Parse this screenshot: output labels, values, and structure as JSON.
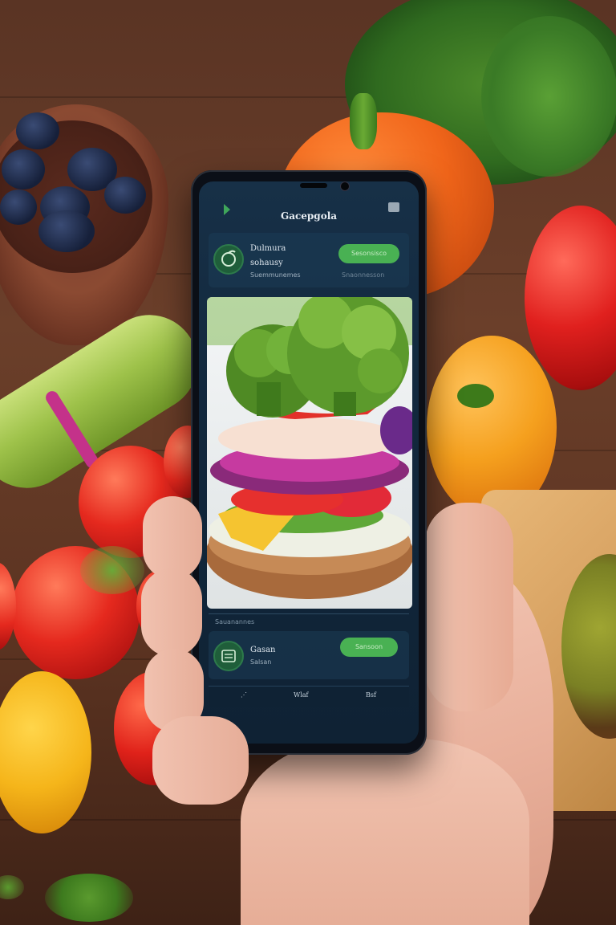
{
  "app": {
    "title": "Gacepgola"
  },
  "header_card": {
    "line1": "Dulmura",
    "line2": "sohausy",
    "line3": "Suemmunemes",
    "button_label": "Sesonsisco",
    "button_sub": "Snaonnesson"
  },
  "lower_card": {
    "caption": "Sauanannes",
    "line1": "Gasan",
    "line2": "Salsan",
    "button_label": "Sansoon"
  },
  "bottom_nav": {
    "item1": "⋰",
    "item2": "Wlaf",
    "item3": "Bsf"
  },
  "colors": {
    "accent": "#49b153",
    "screen_bg": "#12283d",
    "wood": "#5a3424"
  },
  "icons": [
    "back-chevron-icon",
    "menu-icon",
    "leaf-logo-icon",
    "checklist-icon"
  ]
}
